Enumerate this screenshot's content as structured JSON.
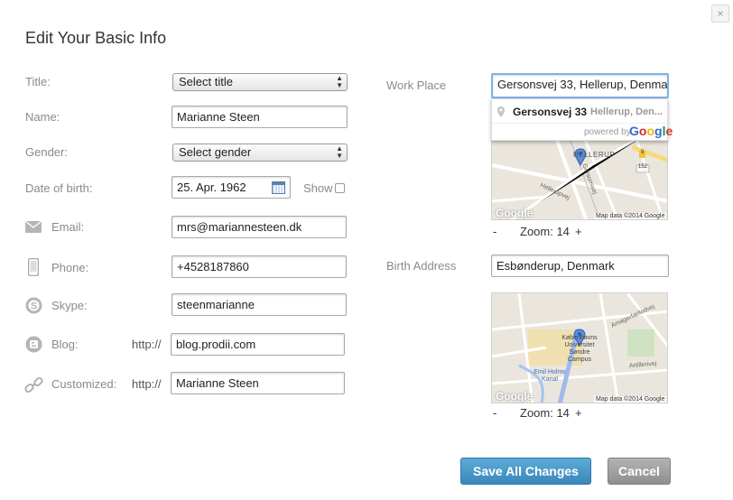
{
  "dialog": {
    "title": "Edit Your Basic Info",
    "close_label": "×"
  },
  "fields": {
    "title": {
      "label": "Title:",
      "value": "Select title"
    },
    "name": {
      "label": "Name:",
      "value": "Marianne Steen"
    },
    "gender": {
      "label": "Gender:",
      "value": "Select gender"
    },
    "dob": {
      "label": "Date of birth:",
      "value": "25. Apr. 1962",
      "show_label": "Show",
      "show_checked": false
    },
    "email": {
      "label": "Email:",
      "value": "mrs@mariannesteen.dk",
      "icon": "envelope-icon"
    },
    "phone": {
      "label": "Phone:",
      "value": "+4528187860",
      "icon": "phone-icon"
    },
    "skype": {
      "label": "Skype:",
      "value": "steenmarianne",
      "icon": "skype-icon"
    },
    "blog": {
      "label": "Blog:",
      "prefix": "http://",
      "value": "blog.prodii.com",
      "icon": "blogger-icon"
    },
    "customized": {
      "label": "Customized:",
      "prefix": "http://",
      "value": "Marianne Steen",
      "icon": "link-icon"
    }
  },
  "work_place": {
    "label": "Work Place",
    "value": "Gersonsvej 33, Hellerup, Denma",
    "autocomplete": {
      "main": "Gersonsvej 33",
      "sub": "Hellerup, Den...",
      "powered_by": "powered by",
      "google": "Google"
    },
    "map": {
      "labels": [
        "HELLERUP",
        "Hellerupvej",
        "Gersonsvej",
        "Margrethevej",
        "152",
        "9"
      ],
      "logo": "Google",
      "attribution": "Map data ©2014 Google"
    },
    "zoom_minus": "-",
    "zoom_text": "Zoom: 14",
    "zoom_plus": "+"
  },
  "birth_address": {
    "label": "Birth Address",
    "value": "Esbønderup, Denmark",
    "map": {
      "labels": [
        "Københavns Universitet Søndre Campus",
        "Emil Holms Kanal",
        "Amagerfælledvej",
        "Artillerivej"
      ],
      "logo": "Google",
      "attribution": "Map data ©2014 Google"
    },
    "zoom_minus": "-",
    "zoom_text": "Zoom: 14",
    "zoom_plus": "+"
  },
  "actions": {
    "save": "Save All Changes",
    "cancel": "Cancel"
  },
  "colors": {
    "save_button": "#4a9ccb",
    "cancel_button": "#a0a0a0",
    "focus_border": "#7fb1e6"
  }
}
